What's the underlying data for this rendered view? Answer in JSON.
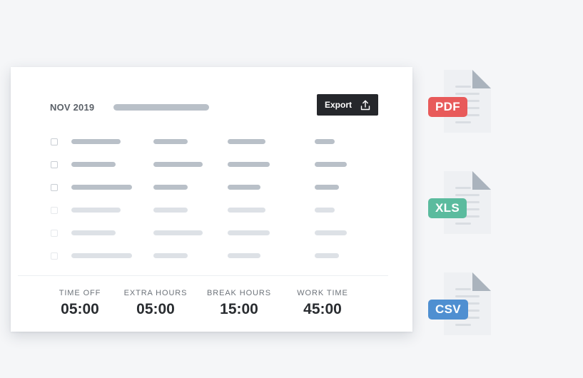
{
  "report": {
    "month": "NOV 2019",
    "export_label": "Export"
  },
  "rows": [
    {
      "bars": [
        75,
        58,
        67,
        42
      ],
      "faded": false
    },
    {
      "bars": [
        67,
        83,
        75,
        67
      ],
      "faded": false
    },
    {
      "bars": [
        92,
        58,
        58,
        50
      ],
      "faded": false
    },
    {
      "bars": [
        75,
        58,
        67,
        42
      ],
      "faded": true
    },
    {
      "bars": [
        67,
        83,
        75,
        67
      ],
      "faded": true
    },
    {
      "bars": [
        92,
        58,
        58,
        50
      ],
      "faded": true
    }
  ],
  "stats": [
    {
      "label": "TIME OFF",
      "value": "05:00"
    },
    {
      "label": "EXTRA HOURS",
      "value": "05:00"
    },
    {
      "label": "BREAK HOURS",
      "value": "15:00"
    },
    {
      "label": "WORK TIME",
      "value": "45:00"
    }
  ],
  "formats": [
    {
      "label": "PDF",
      "color": "#e85a5a"
    },
    {
      "label": "XLS",
      "color": "#5bbb9e"
    },
    {
      "label": "CSV",
      "color": "#4f8fd1"
    }
  ],
  "colors": {
    "placeholder": "#b9c0c8",
    "placeholder_faded": "#dde1e6",
    "button_bg": "#25272b",
    "file_body": "#eef0f3",
    "file_fold": "#aab3bd"
  }
}
